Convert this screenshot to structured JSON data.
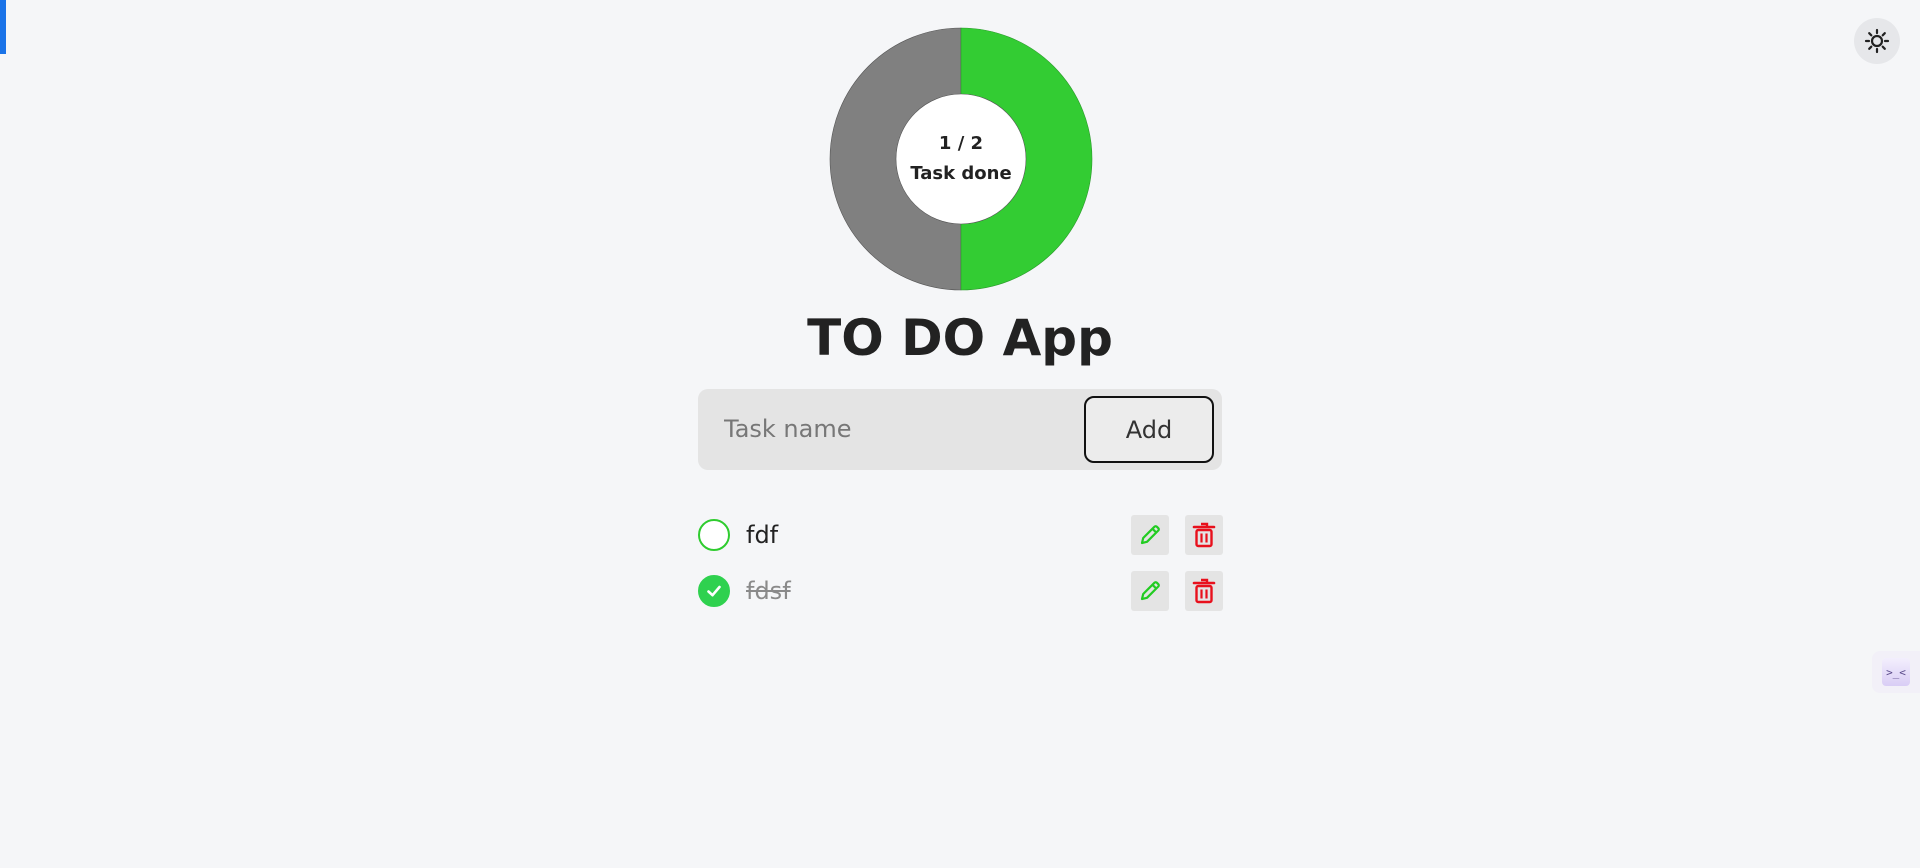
{
  "progress": {
    "done": 1,
    "total": 2,
    "count_text": "1 / 2",
    "label": "Task done",
    "done_color": "#33cc33",
    "remaining_color": "#808080"
  },
  "app": {
    "title": "TO DO App"
  },
  "form": {
    "placeholder": "Task name",
    "value": "",
    "add_label": "Add"
  },
  "tasks": [
    {
      "name": "fdf",
      "completed": false
    },
    {
      "name": "fdsf",
      "completed": true
    }
  ],
  "icons": {
    "theme": "sun-icon",
    "edit": "pencil-icon",
    "delete": "trash-icon",
    "check": "checkmark-icon"
  },
  "colors": {
    "accent": "#1a73e8",
    "check_green": "#2fd14f",
    "edit_green": "#22cc22",
    "delete_red": "#e8101c"
  },
  "side_widget": {
    "text": ">_<"
  }
}
